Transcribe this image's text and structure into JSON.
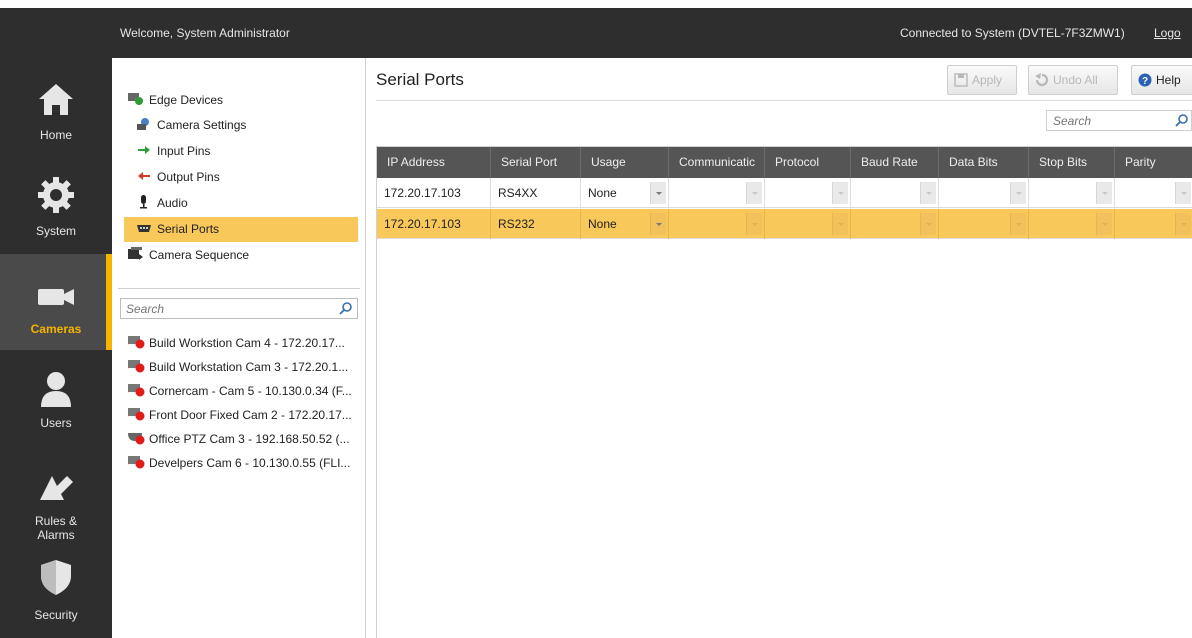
{
  "topbar": {
    "welcome": "Welcome, System Administrator",
    "connected": "Connected to System (DVTEL-7F3ZMW1)",
    "logout": "Logo"
  },
  "nav": [
    {
      "label": "Home",
      "icon": "home-icon"
    },
    {
      "label": "System",
      "icon": "gear-icon"
    },
    {
      "label": "Cameras",
      "icon": "camera-icon",
      "active": true
    },
    {
      "label": "Users",
      "icon": "user-icon"
    },
    {
      "label": "Rules &\nAlarms",
      "icon": "rules-alarms-icon"
    },
    {
      "label": "Security",
      "icon": "shield-icon"
    }
  ],
  "tree": {
    "edge_devices": "Edge Devices",
    "camera_settings": "Camera Settings",
    "input_pins": "Input Pins",
    "output_pins": "Output Pins",
    "audio": "Audio",
    "serial_ports": "Serial Ports",
    "camera_sequence": "Camera Sequence"
  },
  "camera_search": {
    "placeholder": "Search"
  },
  "cameras": [
    "Build Workstion Cam 4 - 172.20.17...",
    "Build Workstation Cam 3 - 172.20.1...",
    "Cornercam - Cam 5 - 10.130.0.34 (F...",
    "Front Door Fixed Cam 2 - 172.20.17...",
    "Office PTZ Cam 3 - 192.168.50.52 (...",
    "Develpers Cam 6 - 10.130.0.55 (FLI..."
  ],
  "main": {
    "title": "Serial Ports",
    "apply": "Apply",
    "undo_all": "Undo All",
    "help": "Help",
    "search_placeholder": "Search"
  },
  "grid": {
    "columns": [
      "IP Address",
      "Serial Port",
      "Usage",
      "Communicatic",
      "Protocol",
      "Baud Rate",
      "Data Bits",
      "Stop Bits",
      "Parity"
    ],
    "rows": [
      {
        "ip": "172.20.17.103",
        "port": "RS4XX",
        "usage": "None"
      },
      {
        "ip": "172.20.17.103",
        "port": "RS232",
        "usage": "None",
        "selected": true
      }
    ]
  },
  "colors": {
    "accent": "#f5b400",
    "selection": "#f8c85a",
    "chrome": "#2e2e2e"
  }
}
